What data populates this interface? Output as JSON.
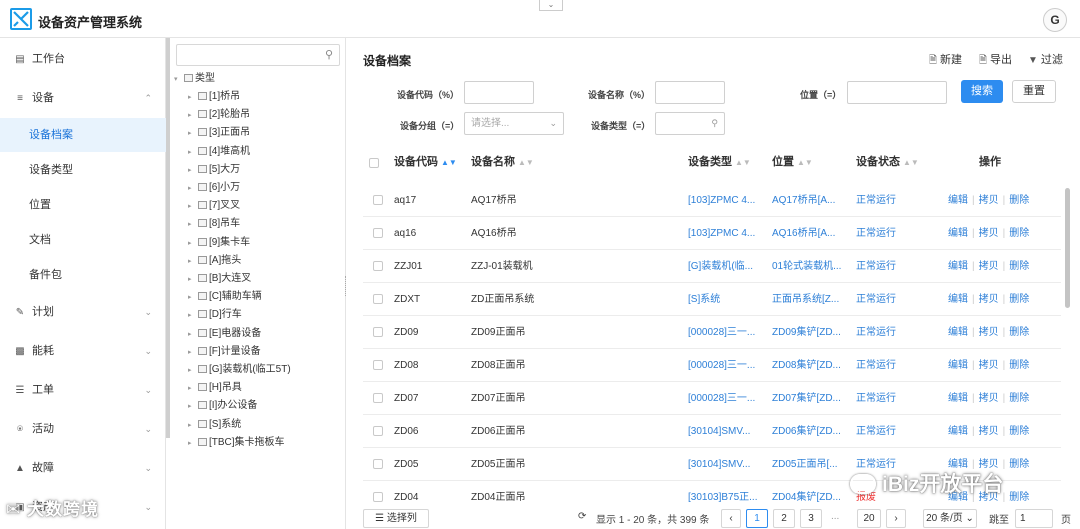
{
  "header": {
    "app_title": "设备资产管理系统",
    "avatar_letter": "G"
  },
  "sidebar": {
    "items": [
      {
        "id": "workbench",
        "label": "工作台",
        "icon": "monitor-icon"
      },
      {
        "id": "equipment",
        "label": "设备",
        "icon": "list-icon",
        "expanded": true,
        "children": [
          {
            "label": "设备档案",
            "active": true
          },
          {
            "label": "设备类型"
          },
          {
            "label": "位置"
          },
          {
            "label": "文档"
          },
          {
            "label": "备件包"
          }
        ]
      },
      {
        "id": "plan",
        "label": "计划",
        "icon": "edit-icon"
      },
      {
        "id": "energy",
        "label": "能耗",
        "icon": "bar-chart-icon"
      },
      {
        "id": "workorder",
        "label": "工单",
        "icon": "menu-icon"
      },
      {
        "id": "activity",
        "label": "活动",
        "icon": "bank-icon"
      },
      {
        "id": "fault",
        "label": "故障",
        "icon": "warning-icon"
      },
      {
        "id": "asset",
        "label": "资产",
        "icon": "box-icon"
      }
    ]
  },
  "tree": {
    "root": "类型",
    "nodes": [
      "[1]桥吊",
      "[2]轮胎吊",
      "[3]正面吊",
      "[4]堆高机",
      "[5]大万",
      "[6]小万",
      "[7]叉叉",
      "[8]吊车",
      "[9]集卡车",
      "[A]拖头",
      "[B]大连叉",
      "[C]辅助车辆",
      "[D]行车",
      "[E]电器设备",
      "[F]计量设备",
      "[G]装载机(临工5T)",
      "[H]吊具",
      "[I]办公设备",
      "[S]系统",
      "[TBC]集卡拖板车"
    ]
  },
  "main": {
    "title": "设备档案",
    "toolbar": {
      "new": "新建",
      "export": "导出",
      "filter": "过滤"
    },
    "filters": {
      "code_label": "设备代码（%）",
      "name_label": "设备名称（%）",
      "location_label": "位置（=）",
      "group_label": "设备分组（=）",
      "group_placeholder": "请选择...",
      "type_label": "设备类型（=）",
      "search_btn": "搜索",
      "reset_btn": "重置"
    },
    "columns": [
      "设备代码",
      "设备名称",
      "设备类型",
      "位置",
      "设备状态",
      "操作"
    ],
    "ops": [
      "编辑",
      "拷贝",
      "删除"
    ],
    "rows": [
      {
        "code": "aq17",
        "name": "AQ17桥吊",
        "type": "[103]ZPMC 4...",
        "location": "AQ17桥吊[A...",
        "status": "正常运行"
      },
      {
        "code": "aq16",
        "name": "AQ16桥吊",
        "type": "[103]ZPMC 4...",
        "location": "AQ16桥吊[A...",
        "status": "正常运行"
      },
      {
        "code": "ZZJ01",
        "name": "ZZJ-01装载机",
        "type": "[G]装载机(临...",
        "location": "01轮式装载机...",
        "status": "正常运行"
      },
      {
        "code": "ZDXT",
        "name": "ZD正面吊系统",
        "type": "[S]系统",
        "location": "正面吊系统[Z...",
        "status": "正常运行"
      },
      {
        "code": "ZD09",
        "name": "ZD09正面吊",
        "type": "[000028]三一...",
        "location": "ZD09集铲[ZD...",
        "status": "正常运行"
      },
      {
        "code": "ZD08",
        "name": "ZD08正面吊",
        "type": "[000028]三一...",
        "location": "ZD08集铲[ZD...",
        "status": "正常运行"
      },
      {
        "code": "ZD07",
        "name": "ZD07正面吊",
        "type": "[000028]三一...",
        "location": "ZD07集铲[ZD...",
        "status": "正常运行"
      },
      {
        "code": "ZD06",
        "name": "ZD06正面吊",
        "type": "[30104]SMV...",
        "location": "ZD06集铲[ZD...",
        "status": "正常运行"
      },
      {
        "code": "ZD05",
        "name": "ZD05正面吊",
        "type": "[30104]SMV...",
        "location": "ZD05正面吊[...",
        "status": "正常运行"
      },
      {
        "code": "ZD04",
        "name": "ZD04正面吊",
        "type": "[30103]B75正...",
        "location": "ZD04集铲[ZD...",
        "status": "报废",
        "status_danger": true
      }
    ],
    "footer": {
      "select_columns": "选择列",
      "summary": "显示 1 - 20 条，共 399 条",
      "pages": [
        "1",
        "2",
        "3",
        "...",
        "20"
      ],
      "page_size": "20 条/页",
      "goto_label": "跳至",
      "goto_value": "1",
      "page_unit": "页"
    }
  },
  "watermarks": {
    "left": "大数跨境",
    "right": "iBiz开放平台"
  }
}
